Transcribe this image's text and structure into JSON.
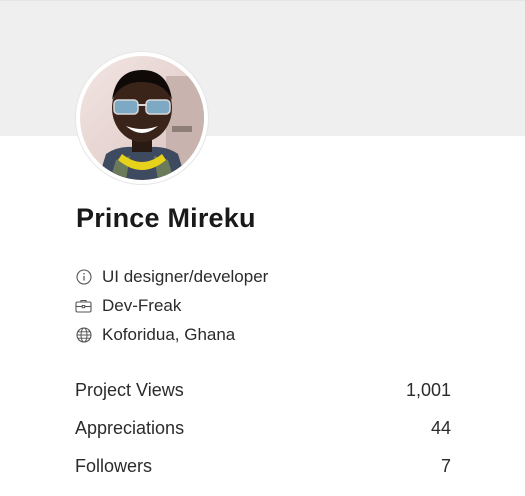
{
  "profile": {
    "name": "Prince Mireku",
    "avatar_alt": "Prince Mireku avatar"
  },
  "info": [
    {
      "icon": "info-icon",
      "text": "UI designer/developer"
    },
    {
      "icon": "briefcase-icon",
      "text": "Dev-Freak"
    },
    {
      "icon": "globe-icon",
      "text": "Koforidua, Ghana"
    }
  ],
  "stats": [
    {
      "label": "Project Views",
      "value": "1,001"
    },
    {
      "label": "Appreciations",
      "value": "44"
    },
    {
      "label": "Followers",
      "value": "7"
    }
  ],
  "colors": {
    "banner": "#efefef",
    "text": "#191919"
  }
}
